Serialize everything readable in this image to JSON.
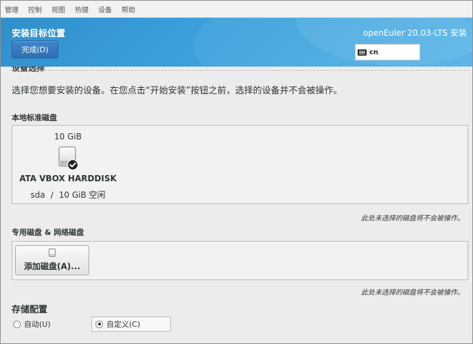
{
  "vm_menu": [
    "管理",
    "控制",
    "视图",
    "热键",
    "设备",
    "帮助"
  ],
  "header": {
    "page_title": "安装目标位置",
    "done_label": "完成(D)",
    "product_title": "openEuler 20.03-LTS 安装",
    "keyboard_layout": "cn"
  },
  "content": {
    "section_heading": "设备选择",
    "intro": "选择您想要安装的设备。在您点击“开始安装”按钮之前，选择的设备并不会被操作。",
    "local_disks_label": "本地标准磁盘",
    "disk": {
      "size": "10 GiB",
      "name": "ATA VBOX HARDDISK",
      "device": "sda",
      "separator": "/",
      "free": "10 GiB 空闲",
      "selected": true,
      "icon": "harddisk-icon"
    },
    "unselected_note": "此处未选择的磁盘将不会被操作。",
    "special_disks_label": "专用磁盘 & 网络磁盘",
    "add_disk_label": "添加磁盘(A)...",
    "unselected_note_2": "此处未选择的磁盘将不会被操作。",
    "storage_config_label": "存储配置",
    "radio_auto": "自动(U)",
    "radio_custom": "自定义(C)",
    "storage_selected": "custom"
  },
  "colors": {
    "header_blue": "#3a9fda",
    "done_button": "#2f6fb3",
    "background": "#ececec"
  }
}
